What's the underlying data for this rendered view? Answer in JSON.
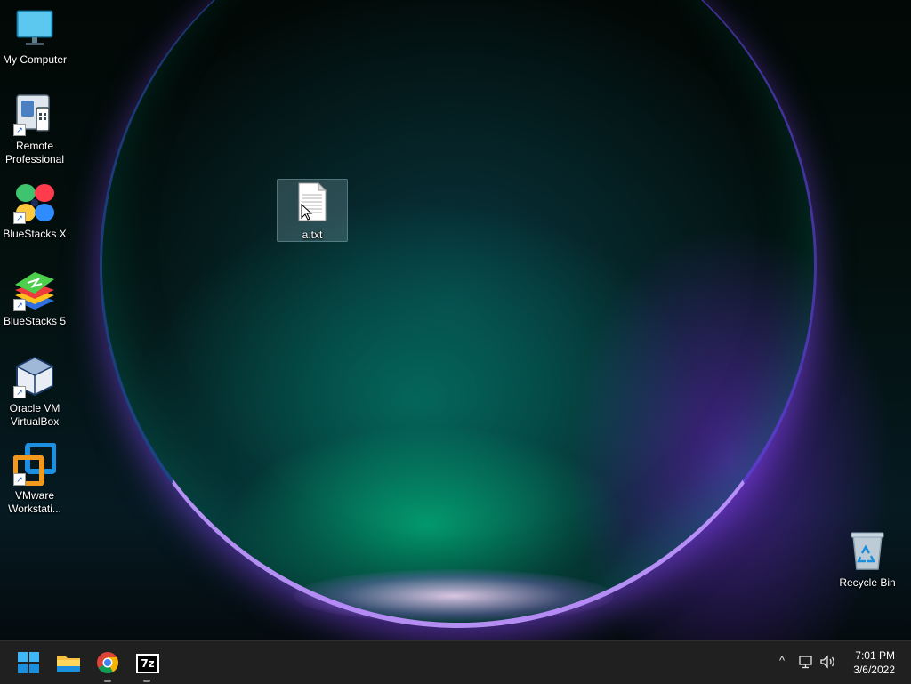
{
  "desktop": {
    "icons": [
      {
        "label": "My Computer",
        "icon": "monitor-icon"
      },
      {
        "label": "Remote\nProfessional",
        "icon": "remote-professional-icon"
      },
      {
        "label": "BlueStacks X",
        "icon": "bluestacks-x-icon"
      },
      {
        "label": "BlueStacks 5",
        "icon": "bluestacks-5-icon"
      },
      {
        "label": "Oracle VM\nVirtualBox",
        "icon": "virtualbox-icon"
      },
      {
        "label": "VMware\nWorkstati...",
        "icon": "vmware-icon"
      }
    ],
    "file": {
      "label": "a.txt",
      "icon": "text-file-icon",
      "selected": true
    },
    "recycle_bin": {
      "label": "Recycle Bin",
      "icon": "recycle-bin-icon"
    }
  },
  "taskbar": {
    "pinned": [
      {
        "name": "Start",
        "icon": "windows-start-icon"
      },
      {
        "name": "File Explorer",
        "icon": "folder-icon"
      },
      {
        "name": "Google Chrome",
        "icon": "chrome-icon",
        "running": true
      },
      {
        "name": "7-Zip",
        "icon": "7zip-icon",
        "running": true,
        "glyph": "7z"
      }
    ],
    "tray": {
      "chevron": "^",
      "icons": [
        "network-icon",
        "volume-icon"
      ]
    },
    "clock": {
      "time": "7:01 PM",
      "date": "3/6/2022"
    }
  },
  "colors": {
    "taskbar": "#202020",
    "accent": "#1a8fe0"
  }
}
